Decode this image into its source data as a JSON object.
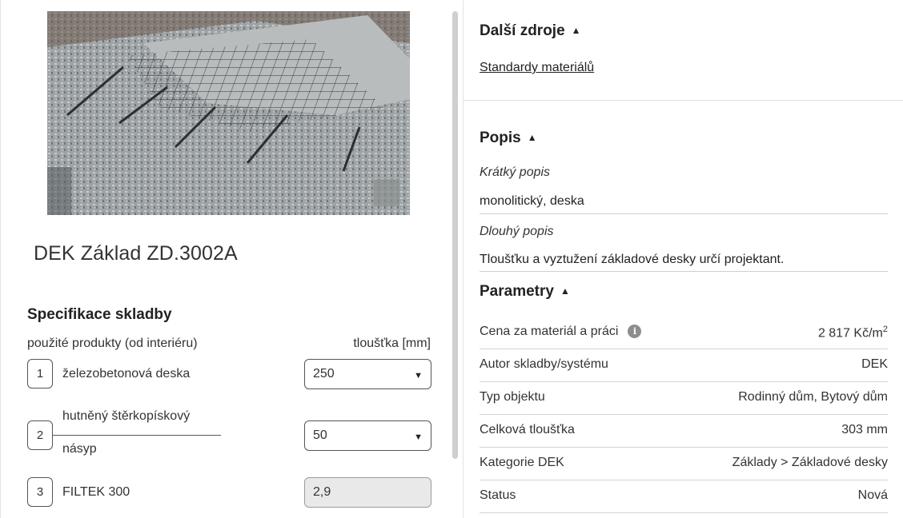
{
  "product": {
    "image_alt": "foundation slab render",
    "title": "DEK Základ ZD.3002A"
  },
  "spec": {
    "heading": "Specifikace skladby",
    "col_products": "použité produkty (od interiéru)",
    "col_thickness": "tloušťka [mm]",
    "layers": [
      {
        "num": "1",
        "name_line1": "železobetonová deska",
        "name_line2": "",
        "thickness": "250",
        "editable": true
      },
      {
        "num": "2",
        "name_line1": "hutněný štěrkopískový",
        "name_line2": "násyp",
        "thickness": "50",
        "editable": true
      },
      {
        "num": "3",
        "name_line1": "FILTEK 300",
        "name_line2": "",
        "thickness": "2,9",
        "editable": false
      }
    ]
  },
  "resources": {
    "title": "Další zdroje",
    "link": "Standardy materiálů"
  },
  "description": {
    "title": "Popis",
    "short_label": "Krátký popis",
    "short_value": "monolitický, deska",
    "long_label": "Dlouhý popis",
    "long_value": "Tloušťku a vyztužení základové desky určí projektant."
  },
  "parameters": {
    "title": "Parametry",
    "price_label": "Cena za materiál a práci",
    "price_value": "2 817 Kč/m",
    "price_unit_sup": "2",
    "rows": [
      {
        "k": "Autor skladby/systému",
        "v": "DEK"
      },
      {
        "k": "Typ objektu",
        "v": "Rodinný dům, Bytový dům"
      },
      {
        "k": "Celková tloušťka",
        "v": "303 mm"
      },
      {
        "k": "Kategorie DEK",
        "v": "Základy > Základové desky"
      },
      {
        "k": "Status",
        "v": "Nová"
      }
    ]
  },
  "icons": {
    "collapse": "triangle-up-icon",
    "dropdown": "caret-down-icon",
    "info": "info-icon"
  },
  "colors": {
    "text": "#222222",
    "border": "#555555",
    "disabled_bg": "#e9e9e9"
  }
}
